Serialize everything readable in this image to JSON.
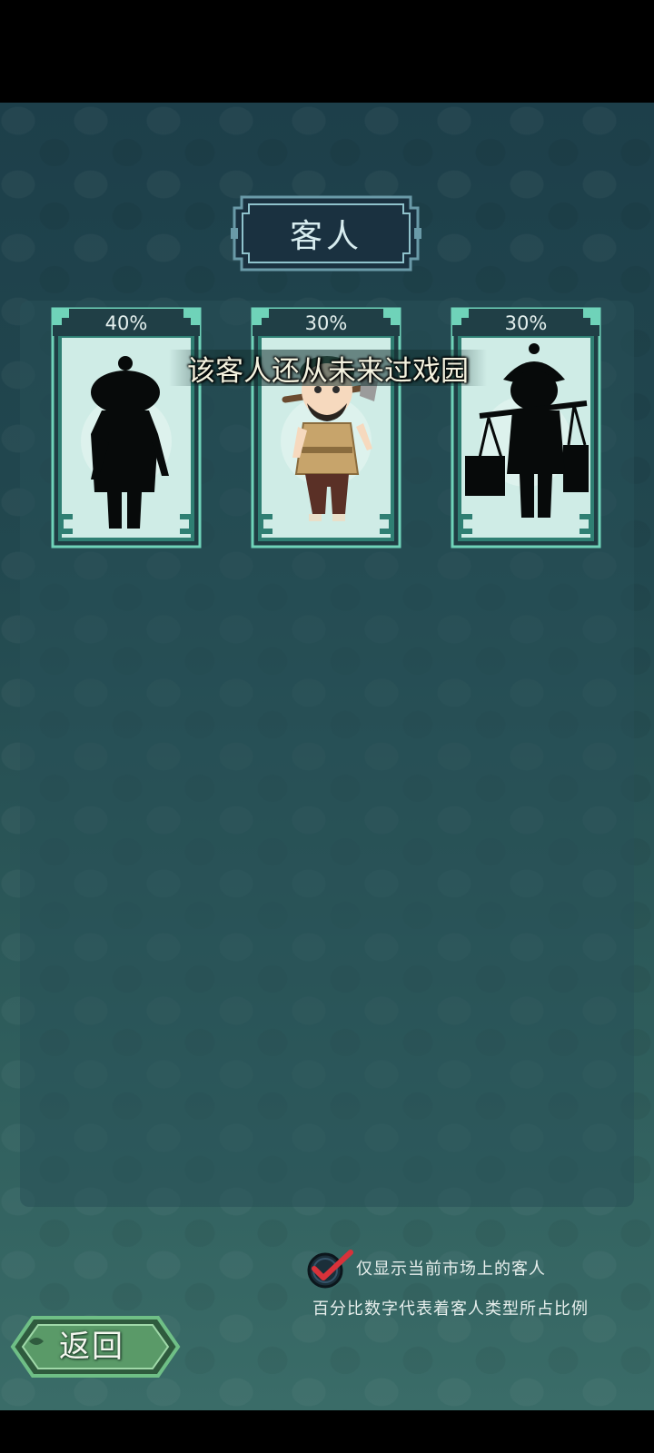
{
  "header": {
    "title": "客人"
  },
  "customers": [
    {
      "percent": "40%",
      "discovered": false,
      "silhouette": "man-with-topknot-silhouette"
    },
    {
      "percent": "30%",
      "discovered": true,
      "silhouette": "bearded-porter-with-shoulder-pole"
    },
    {
      "percent": "30%",
      "discovered": false,
      "silhouette": "peddler-carrying-baskets-silhouette"
    }
  ],
  "tooltip": {
    "text": "该客人还从未来过戏园"
  },
  "filter": {
    "checked": true,
    "label": "仅显示当前市场上的客人"
  },
  "note": {
    "text": "百分比数字代表着客人类型所占比例"
  },
  "footer": {
    "back_label": "返回"
  },
  "colors": {
    "frame": "#6fd3b9",
    "frame_dark": "#2f7f73",
    "card_bg": "#cfece6",
    "check_red": "#d8323a"
  }
}
